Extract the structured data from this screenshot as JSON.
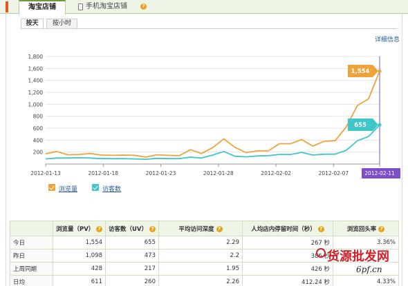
{
  "tabs": {
    "main_label": "淘宝店铺",
    "mobile_label": "手机淘宝店铺"
  },
  "subtabs": {
    "by_day": "按天",
    "by_hour": "按小时"
  },
  "detail_link": "详细信息",
  "colors": {
    "pv": "#eda33a",
    "uv": "#3ec6c8",
    "highlight": "#7b4fc9",
    "grid": "#e6e6e6",
    "help": "#e8a31c"
  },
  "chart_data": {
    "type": "line",
    "x": [
      "2012-01-13",
      "2012-01-14",
      "2012-01-15",
      "2012-01-16",
      "2012-01-17",
      "2012-01-18",
      "2012-01-19",
      "2012-01-20",
      "2012-01-21",
      "2012-01-22",
      "2012-01-23",
      "2012-01-24",
      "2012-01-25",
      "2012-01-26",
      "2012-01-27",
      "2012-01-28",
      "2012-01-29",
      "2012-01-30",
      "2012-01-31",
      "2012-02-01",
      "2012-02-02",
      "2012-02-03",
      "2012-02-04",
      "2012-02-05",
      "2012-02-06",
      "2012-02-07",
      "2012-02-08",
      "2012-02-09",
      "2012-02-10",
      "2012-02-11"
    ],
    "xtick_labels": [
      "2012-01-13",
      "2012-01-18",
      "2012-01-23",
      "2012-01-28",
      "2012-02-02",
      "2012-02-07",
      "2012-02-11"
    ],
    "yticks": [
      "1,800",
      "1,600",
      "1,400",
      "1,200",
      "1,000",
      "800",
      "600",
      "400",
      "200"
    ],
    "ylim": [
      0,
      1800
    ],
    "grid": true,
    "legend_position": "bottom-left",
    "highlight_x_label": "2012-02-11",
    "series": [
      {
        "name": "浏览量",
        "values": [
          170,
          210,
          155,
          160,
          175,
          150,
          145,
          150,
          145,
          115,
          155,
          145,
          140,
          240,
          175,
          275,
          420,
          280,
          190,
          220,
          220,
          340,
          340,
          410,
          300,
          380,
          390,
          620,
          980,
          1090,
          1554
        ],
        "end_label": "1,554"
      },
      {
        "name": "访客数",
        "values": [
          85,
          100,
          100,
          105,
          100,
          90,
          90,
          90,
          85,
          80,
          95,
          90,
          90,
          115,
          100,
          150,
          210,
          130,
          120,
          135,
          140,
          160,
          160,
          195,
          150,
          165,
          165,
          230,
          390,
          460,
          655
        ],
        "end_label": "655"
      }
    ]
  },
  "stats_table": {
    "headers": [
      "",
      "浏览量（PV）",
      "访客数（UV）",
      "平均访问深度",
      "人均店内停留时间（秒）",
      "浏览回头率"
    ],
    "rows": [
      [
        "今日",
        "1,554",
        "655",
        "2.29",
        "267 秒",
        "3.36%"
      ],
      [
        "昨日",
        "1,098",
        "473",
        "2.2",
        "386 秒",
        ""
      ],
      [
        "上周同期",
        "428",
        "217",
        "1.95",
        "426 秒",
        ""
      ],
      [
        "日均",
        "611",
        "260",
        "2.26",
        "412.24 秒",
        "4.33%"
      ]
    ]
  },
  "watermark": {
    "text": "货源批发网",
    "site": "6pf.cn"
  }
}
